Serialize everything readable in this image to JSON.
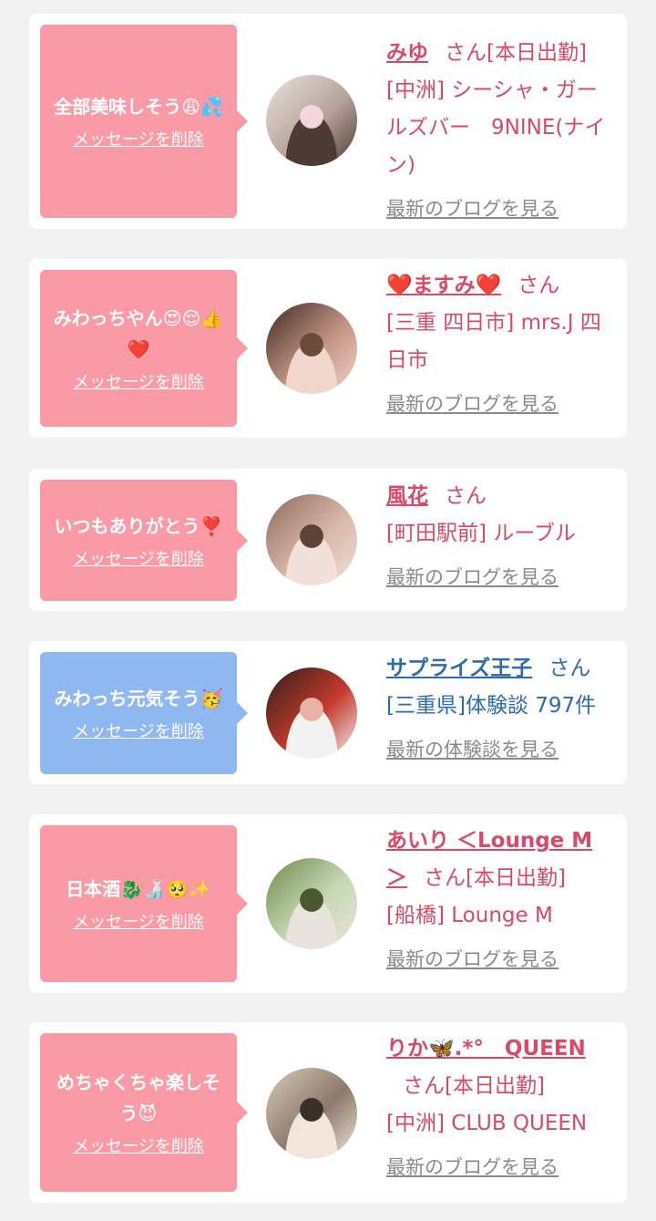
{
  "messages": [
    {
      "theme": "pink",
      "message": "全部美味しそう😩💦",
      "delete_label": "メッセージを削除",
      "name": "みゆ",
      "suffix": "さん[本日出勤]",
      "detail": "[中洲] シーシャ・ガールズバー　9NINE(ナイン)",
      "link": "最新のブログを見る",
      "avatar_colors": [
        "#e9e3de",
        "#b7a49a",
        "#4d3c35",
        "#f4d7dd"
      ]
    },
    {
      "theme": "pink",
      "message": "みわっちやん😍😌👍❤️",
      "delete_label": "メッセージを削除",
      "name": "❤️ますみ❤️",
      "suffix": "さん",
      "detail": "[三重 四日市] mrs.J 四日市",
      "link": "最新のブログを見る",
      "avatar_colors": [
        "#3e2a22",
        "#c29484",
        "#f1d6cc",
        "#6b4a3c"
      ]
    },
    {
      "theme": "pink",
      "message": "いつもありがとう❣️",
      "delete_label": "メッセージを削除",
      "name": "風花",
      "suffix": "さん",
      "detail": "[町田駅前] ルーブル",
      "link": "最新のブログを見る",
      "avatar_colors": [
        "#8b6a5c",
        "#d9b7a8",
        "#f1e1da",
        "#5d4238"
      ]
    },
    {
      "theme": "blue",
      "message": "みわっち元気そう🥳",
      "delete_label": "メッセージを削除",
      "name": "サプライズ王子",
      "suffix": "さん",
      "detail": "[三重県]体験談 797件",
      "link": "最新の体験談を見る",
      "avatar_colors": [
        "#2b1f1a",
        "#c43a2d",
        "#f2f2f2",
        "#e9b2a2"
      ]
    },
    {
      "theme": "pink",
      "message": "日本酒🐉🍶🥺✨",
      "delete_label": "メッセージを削除",
      "name": "あいり ＜Lounge M＞",
      "suffix": "さん[本日出勤]",
      "detail": "[船橋] Lounge M",
      "link": "最新のブログを見る",
      "avatar_colors": [
        "#6f8b4b",
        "#c7d8b5",
        "#e9e3dd",
        "#4a5a2e"
      ]
    },
    {
      "theme": "pink",
      "message": "めちゃくちゃ楽しそう😈",
      "delete_label": "メッセージを削除",
      "name": "りか🦋.*°　QUEEN",
      "suffix": "さん[本日出勤]",
      "detail": "[中洲] CLUB QUEEN",
      "link": "最新のブログを見る",
      "avatar_colors": [
        "#d8c9b8",
        "#8c7a6b",
        "#f2e6da",
        "#3a2f29"
      ]
    }
  ]
}
